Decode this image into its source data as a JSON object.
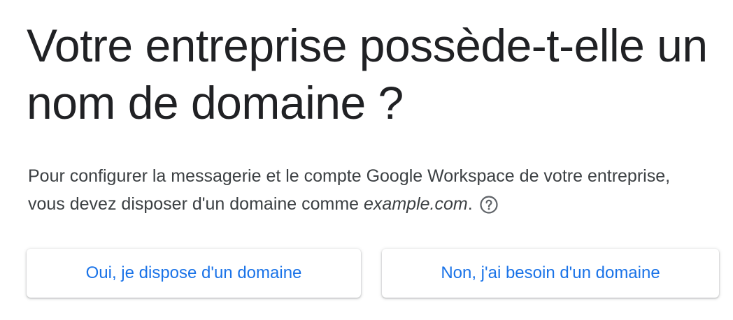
{
  "heading": {
    "title": "Votre entreprise possède-t-elle un nom de domaine ?"
  },
  "description": {
    "text_before": "Pour configurer la messagerie et le compte Google Workspace de votre entreprise, vous devez disposer d'un domaine comme ",
    "example_domain": "example.com",
    "text_after": ".",
    "help_icon": "help-circle-icon"
  },
  "actions": {
    "has_domain_label": "Oui, je dispose d'un domaine",
    "need_domain_label": "Non, j'ai besoin d'un domaine"
  },
  "colors": {
    "accent": "#1a73e8",
    "text_primary": "#202124",
    "text_secondary": "#3c4043",
    "icon": "#5f6368"
  }
}
